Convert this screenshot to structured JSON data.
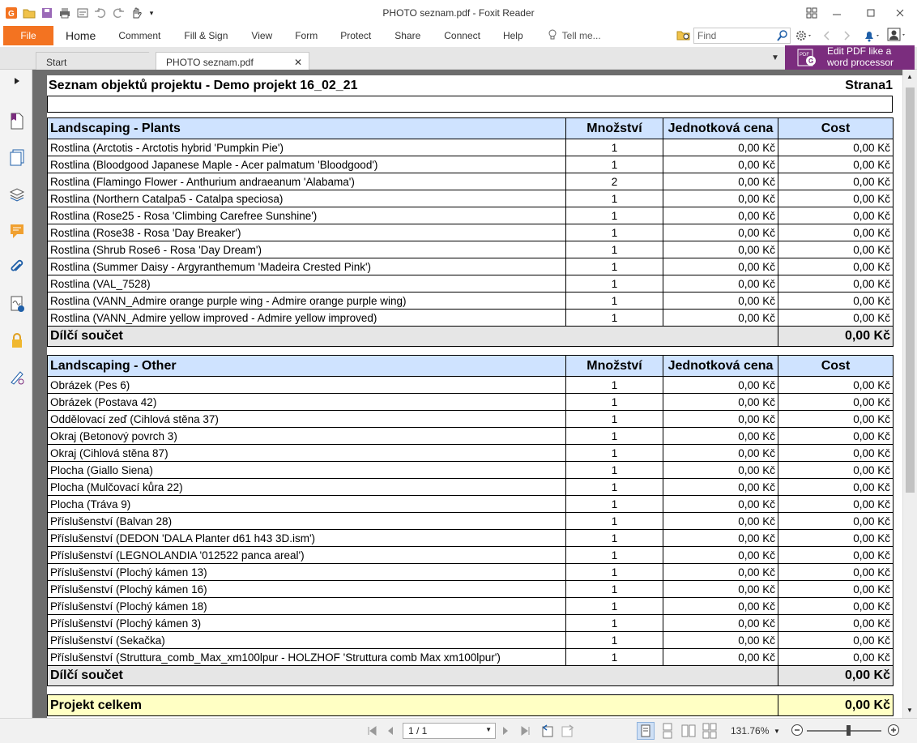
{
  "window": {
    "title": "PHOTO seznam.pdf - Foxit Reader"
  },
  "menu": {
    "file": "File",
    "items": [
      "Home",
      "Comment",
      "Fill & Sign",
      "View",
      "Form",
      "Protect",
      "Share",
      "Connect",
      "Help"
    ],
    "tell_me": "Tell me..."
  },
  "search": {
    "placeholder": "Find"
  },
  "tabs": [
    {
      "label": "Start"
    },
    {
      "label": "PHOTO seznam.pdf"
    }
  ],
  "promo": {
    "line1": "Edit PDF like a",
    "line2": "word processor"
  },
  "status": {
    "page": "1 / 1",
    "zoom": "131.76%"
  },
  "document": {
    "title": "Seznam objektů projektu - Demo projekt 16_02_21",
    "page_label": "Strana1",
    "columns": {
      "qty": "Množství",
      "unit": "Jednotková cena",
      "cost": "Cost"
    },
    "sections": [
      {
        "name": "Landscaping - Plants",
        "rows": [
          {
            "item": "Rostlina (Arctotis - Arctotis hybrid 'Pumpkin Pie')",
            "qty": "1",
            "unit": "0,00 Kč",
            "cost": "0,00 Kč"
          },
          {
            "item": "Rostlina (Bloodgood Japanese Maple - Acer palmatum 'Bloodgood')",
            "qty": "1",
            "unit": "0,00 Kč",
            "cost": "0,00 Kč"
          },
          {
            "item": "Rostlina (Flamingo Flower - Anthurium andraeanum 'Alabama')",
            "qty": "2",
            "unit": "0,00 Kč",
            "cost": "0,00 Kč"
          },
          {
            "item": "Rostlina (Northern Catalpa5 - Catalpa speciosa)",
            "qty": "1",
            "unit": "0,00 Kč",
            "cost": "0,00 Kč"
          },
          {
            "item": "Rostlina (Rose25 - Rosa 'Climbing Carefree Sunshine')",
            "qty": "1",
            "unit": "0,00 Kč",
            "cost": "0,00 Kč"
          },
          {
            "item": "Rostlina (Rose38 - Rosa 'Day Breaker')",
            "qty": "1",
            "unit": "0,00 Kč",
            "cost": "0,00 Kč"
          },
          {
            "item": "Rostlina (Shrub Rose6 - Rosa 'Day Dream')",
            "qty": "1",
            "unit": "0,00 Kč",
            "cost": "0,00 Kč"
          },
          {
            "item": "Rostlina (Summer Daisy - Argyranthemum 'Madeira Crested Pink')",
            "qty": "1",
            "unit": "0,00 Kč",
            "cost": "0,00 Kč"
          },
          {
            "item": "Rostlina (VAL_7528)",
            "qty": "1",
            "unit": "0,00 Kč",
            "cost": "0,00 Kč"
          },
          {
            "item": "Rostlina (VANN_Admire orange purple wing - Admire orange purple wing)",
            "qty": "1",
            "unit": "0,00 Kč",
            "cost": "0,00 Kč"
          },
          {
            "item": "Rostlina (VANN_Admire yellow improved - Admire yellow improved)",
            "qty": "1",
            "unit": "0,00 Kč",
            "cost": "0,00 Kč"
          }
        ],
        "subtotal_label": "Dílčí součet",
        "subtotal": "0,00 Kč"
      },
      {
        "name": "Landscaping - Other",
        "rows": [
          {
            "item": "Obrázek (Pes 6)",
            "qty": "1",
            "unit": "0,00 Kč",
            "cost": "0,00 Kč"
          },
          {
            "item": "Obrázek (Postava 42)",
            "qty": "1",
            "unit": "0,00 Kč",
            "cost": "0,00 Kč"
          },
          {
            "item": "Oddělovací zeď (Cihlová stěna 37)",
            "qty": "1",
            "unit": "0,00 Kč",
            "cost": "0,00 Kč"
          },
          {
            "item": "Okraj (Betonový povrch 3)",
            "qty": "1",
            "unit": "0,00 Kč",
            "cost": "0,00 Kč"
          },
          {
            "item": "Okraj (Cihlová stěna 87)",
            "qty": "1",
            "unit": "0,00 Kč",
            "cost": "0,00 Kč"
          },
          {
            "item": "Plocha (Giallo Siena)",
            "qty": "1",
            "unit": "0,00 Kč",
            "cost": "0,00 Kč"
          },
          {
            "item": "Plocha (Mulčovací kůra 22)",
            "qty": "1",
            "unit": "0,00 Kč",
            "cost": "0,00 Kč"
          },
          {
            "item": "Plocha (Tráva 9)",
            "qty": "1",
            "unit": "0,00 Kč",
            "cost": "0,00 Kč"
          },
          {
            "item": "Příslušenství (Balvan 28)",
            "qty": "1",
            "unit": "0,00 Kč",
            "cost": "0,00 Kč"
          },
          {
            "item": "Příslušenství (DEDON 'DALA Planter d61 h43 3D.ism')",
            "qty": "1",
            "unit": "0,00 Kč",
            "cost": "0,00 Kč"
          },
          {
            "item": "Příslušenství (LEGNOLANDIA '012522 panca areal')",
            "qty": "1",
            "unit": "0,00 Kč",
            "cost": "0,00 Kč"
          },
          {
            "item": "Příslušenství (Plochý kámen 13)",
            "qty": "1",
            "unit": "0,00 Kč",
            "cost": "0,00 Kč"
          },
          {
            "item": "Příslušenství (Plochý kámen 16)",
            "qty": "1",
            "unit": "0,00 Kč",
            "cost": "0,00 Kč"
          },
          {
            "item": "Příslušenství (Plochý kámen 18)",
            "qty": "1",
            "unit": "0,00 Kč",
            "cost": "0,00 Kč"
          },
          {
            "item": "Příslušenství (Plochý kámen 3)",
            "qty": "1",
            "unit": "0,00 Kč",
            "cost": "0,00 Kč"
          },
          {
            "item": "Příslušenství (Sekačka)",
            "qty": "1",
            "unit": "0,00 Kč",
            "cost": "0,00 Kč"
          },
          {
            "item": "Příslušenství (Struttura_comb_Max_xm100lpur - HOLZHOF 'Struttura comb Max xm100lpur')",
            "qty": "1",
            "unit": "0,00 Kč",
            "cost": "0,00 Kč"
          }
        ],
        "subtotal_label": "Dílčí součet",
        "subtotal": "0,00 Kč"
      }
    ],
    "total_label": "Projekt celkem",
    "total": "0,00 Kč"
  }
}
